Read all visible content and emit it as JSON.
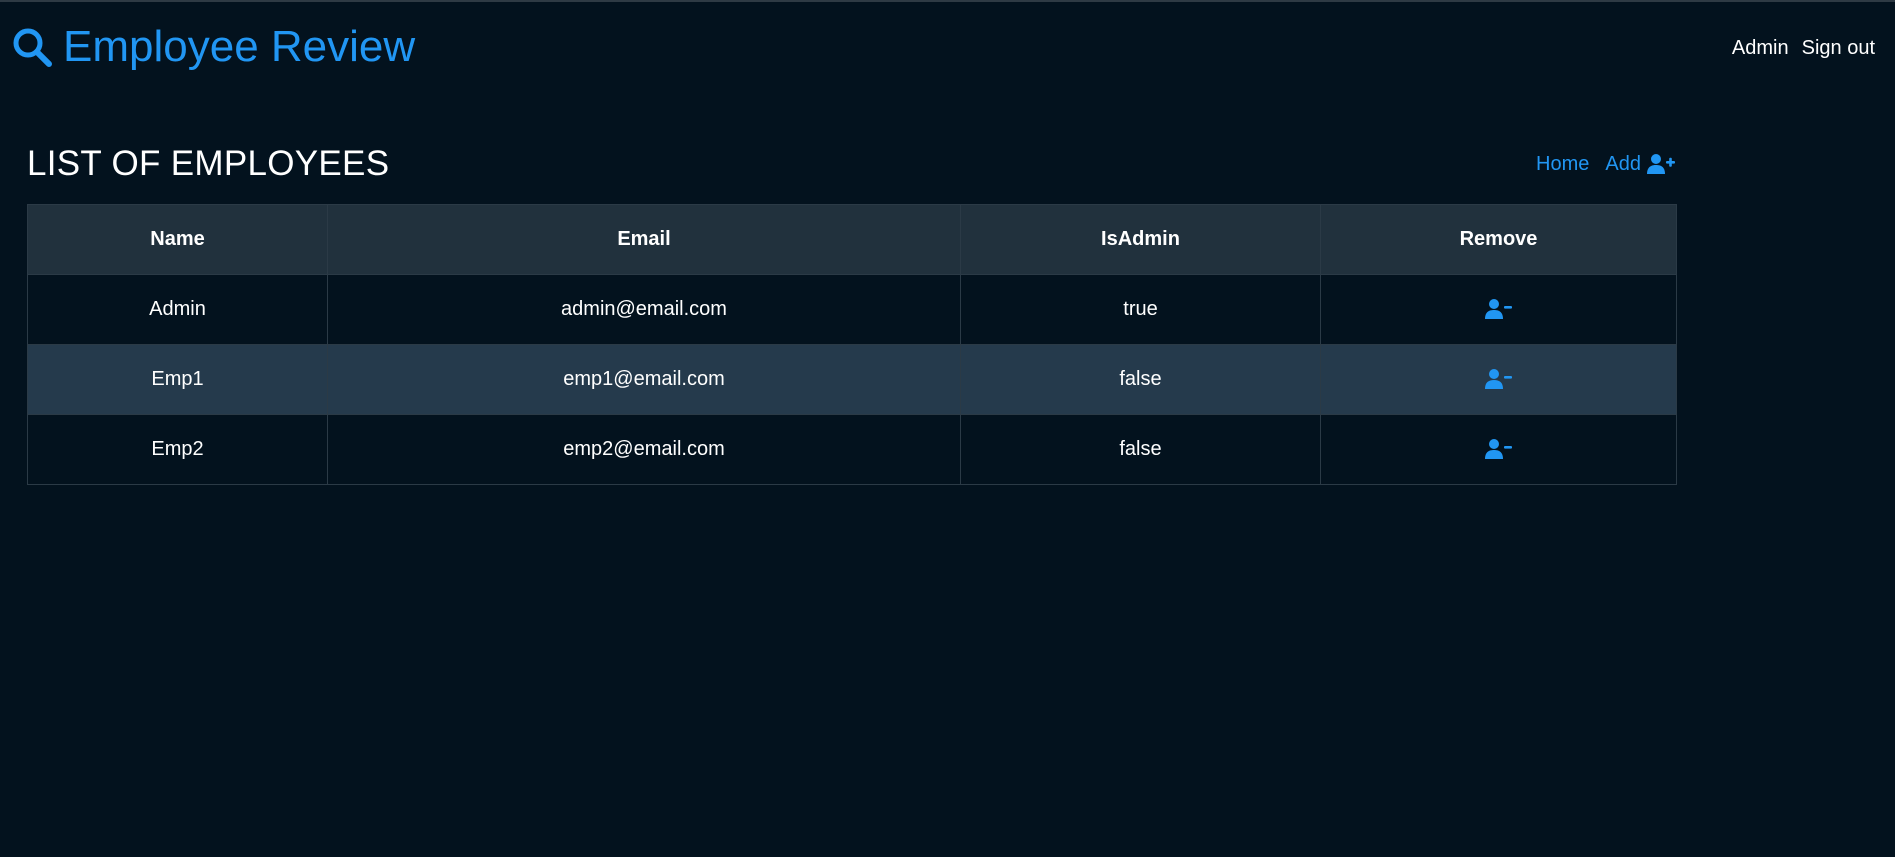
{
  "brand": {
    "title": "Employee Review",
    "icon": "search-icon",
    "color": "#2196f3"
  },
  "user_nav": {
    "user": "Admin",
    "sign_out": "Sign out"
  },
  "page": {
    "title": "LIST OF EMPLOYEES",
    "actions": {
      "home": "Home",
      "add": "Add",
      "add_icon": "user-plus-icon"
    }
  },
  "table": {
    "columns": [
      "Name",
      "Email",
      "IsAdmin",
      "Remove"
    ],
    "rows": [
      {
        "name": "Admin",
        "email": "admin@email.com",
        "is_admin": "true",
        "remove_icon": "user-minus-icon"
      },
      {
        "name": "Emp1",
        "email": "emp1@email.com",
        "is_admin": "false",
        "remove_icon": "user-minus-icon"
      },
      {
        "name": "Emp2",
        "email": "emp2@email.com",
        "is_admin": "false",
        "remove_icon": "user-minus-icon"
      }
    ]
  },
  "colors": {
    "background": "#03121e",
    "accent": "#2196f3",
    "header_row": "#21313d",
    "alt_row": "#253a4c"
  }
}
